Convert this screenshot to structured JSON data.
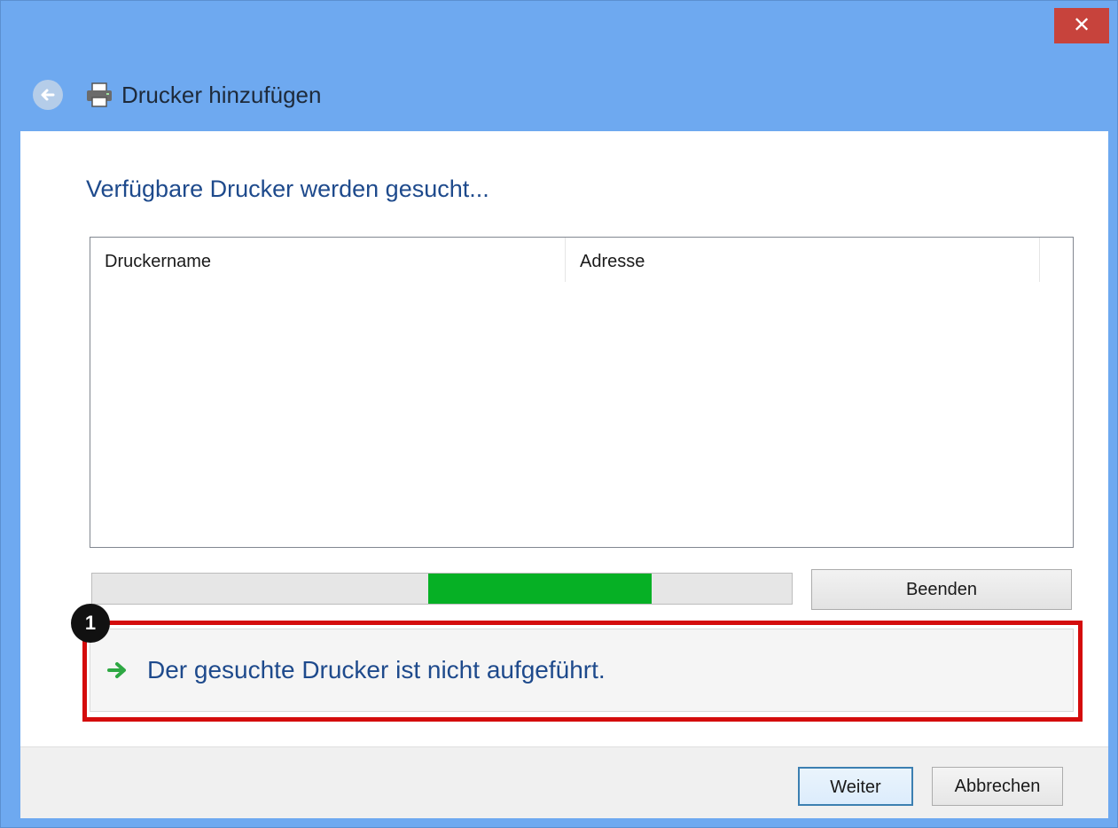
{
  "window": {
    "title": "Drucker hinzufügen",
    "close_label": "✕",
    "accent_color": "#6ea9f0"
  },
  "icons": {
    "back": "back-arrow-icon",
    "printer": "printer-icon",
    "link_arrow": "green-arrow-icon"
  },
  "main": {
    "heading": "Verfügbare Drucker werden gesucht...",
    "columns": [
      "Druckername",
      "Adresse"
    ],
    "rows": [],
    "progress": {
      "start": 0.48,
      "end": 0.8,
      "color": "#06b025"
    },
    "stop_label": "Beenden",
    "not_listed_link": "Der gesuchte Drucker ist nicht aufgeführt.",
    "annotation_number": "1"
  },
  "footer": {
    "next_label": "Weiter",
    "cancel_label": "Abbrechen"
  }
}
